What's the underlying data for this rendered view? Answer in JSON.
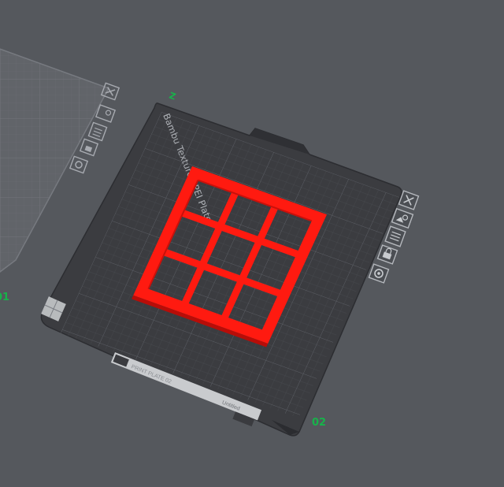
{
  "scene": {
    "background_color": "#55585d",
    "active_plate": {
      "label": "Bambu Textured PEI Plate",
      "number": "02",
      "axis_marker": "Z",
      "plate_color": "#3a3b3f",
      "grid_color": "#55575c",
      "model_color": "#ff1a10",
      "label_color": "#aeb1b6",
      "number_color": "#17b34a",
      "bottom_strip_text": "PRINT PLATE 02",
      "bottom_strip_right_text": "Untitled"
    },
    "neighbor_plate": {
      "number": "01",
      "number_color": "#17b34a"
    },
    "plate_tools": [
      {
        "name": "close",
        "icon": "close-icon"
      },
      {
        "name": "auto-orient",
        "icon": "orient-icon"
      },
      {
        "name": "arrange",
        "icon": "arrange-icon"
      },
      {
        "name": "lock",
        "icon": "lock-icon"
      },
      {
        "name": "settings",
        "icon": "settings-icon"
      }
    ]
  }
}
